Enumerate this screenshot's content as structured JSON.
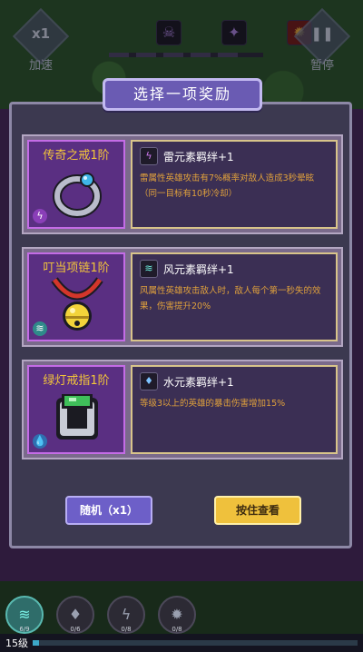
{
  "hud": {
    "speed_value": "x1",
    "speed_label": "加速",
    "pause_label": "暂停",
    "top_icons": [
      "demon-icon",
      "dark-wizard-icon",
      "fire-monster-icon"
    ]
  },
  "panel": {
    "title": "选择一项奖励"
  },
  "cards": [
    {
      "item_name": "传奇之戒1阶",
      "item_icon": "ring-icon",
      "element_icon": "thunder-element-icon",
      "bond_title": "雷元素羁绊+1",
      "description": "雷属性英雄攻击有7%概率对敌人造成3秒晕眩（同一目标有10秒冷却）",
      "accent": "#c46ce6"
    },
    {
      "item_name": "叮当项链1阶",
      "item_icon": "bell-necklace-icon",
      "element_icon": "wind-element-icon",
      "bond_title": "风元素羁绊+1",
      "description": "风属性英雄攻击敌人时，敌人每个第一秒失的效果，伤害提升20%",
      "accent": "#c46ce6"
    },
    {
      "item_name": "绿灯戒指1阶",
      "item_icon": "green-ring-icon",
      "element_icon": "water-element-icon",
      "bond_title": "水元素羁绊+1",
      "description": "等级3以上的英雄的暴击伤害增加15%",
      "accent": "#c46ce6"
    }
  ],
  "buttons": {
    "random": "随机（x1）",
    "hold_view": "按住查看"
  },
  "skills": [
    {
      "icon": "wind-skill-icon",
      "count": "6/9",
      "active": true
    },
    {
      "icon": "water-skill-icon",
      "count": "0/6",
      "active": false
    },
    {
      "icon": "thunder-skill-icon",
      "count": "0/8",
      "active": false
    },
    {
      "icon": "fire-skill-icon",
      "count": "0/8",
      "active": false
    }
  ],
  "level": {
    "label": "15级",
    "xp_fraction": 0.02
  }
}
